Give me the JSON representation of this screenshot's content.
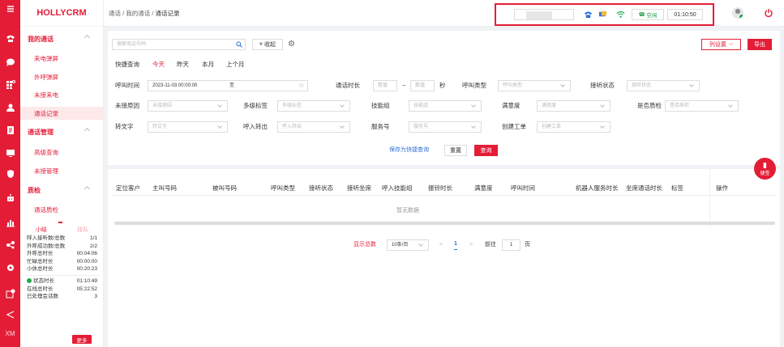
{
  "brand": "HOLLYCRM",
  "rail_icons": [
    "menu-icon",
    "phone-icon",
    "chat-icon",
    "grid-icon",
    "user-icon",
    "document-icon",
    "monitor-icon",
    "shield-icon",
    "robot-icon",
    "chart-icon",
    "share-icon",
    "settings-icon",
    "calendar-icon",
    "send-icon"
  ],
  "rail_footer": "XM",
  "sidebar": {
    "groups": [
      {
        "label": "我的通话",
        "items": [
          "来电弹屏",
          "外呼弹屏",
          "未接来电",
          "通话记录"
        ]
      },
      {
        "label": "通话管理",
        "items": [
          "高级查询",
          "未接管理"
        ]
      },
      {
        "label": "质检",
        "items": [
          "通话质检"
        ]
      }
    ],
    "stats_tabs": {
      "active": "小结",
      "inactive": "技队"
    },
    "stats": [
      {
        "label": "呼入接听数/总数",
        "value": "1/1"
      },
      {
        "label": "外呼成功数/总数",
        "value": "2/2"
      },
      {
        "label": "外呼总时长",
        "value": "00:04:06"
      },
      {
        "label": "忙碌总时长",
        "value": "00:00:00"
      },
      {
        "label": "小休总时长",
        "value": "00:20:23"
      }
    ],
    "stats2": [
      {
        "label": "状态时长",
        "value": "01:10:49"
      },
      {
        "label": "在线总时长",
        "value": "05:22:52"
      },
      {
        "label": "已处理会话数",
        "value": "3"
      }
    ],
    "more": "更多"
  },
  "breadcrumb": [
    "通话",
    "我的通话",
    "通话记录"
  ],
  "topbar": {
    "state": "空闲",
    "timer": "01:10:50"
  },
  "filters": {
    "search_placeholder": "搜索电话号码",
    "collapse_label": "收起",
    "column_settings": "列设置",
    "export": "导出",
    "quick_label": "快捷查询",
    "quick": [
      "今天",
      "昨天",
      "本月",
      "上个月"
    ],
    "call_time_label": "呼叫时间",
    "call_time_value": "2023-11-03 00:00:00",
    "to_label": "至",
    "duration_label": "通话时长",
    "min_placeholder": "数值",
    "max_placeholder": "数值",
    "sec": "秒",
    "call_type_label": "呼叫类型",
    "call_type_placeholder": "呼叫类型",
    "answer_label": "接听状态",
    "answer_placeholder": "接听状态",
    "missed_label": "未接原因",
    "missed_placeholder": "未接原因",
    "tags_label": "多级标签",
    "tags_placeholder": "多级标签",
    "skill_label": "技能组",
    "skill_placeholder": "技能组",
    "satisfaction_label": "满意度",
    "satisfaction_placeholder": "满意度",
    "qc_label": "是否质检",
    "qc_placeholder": "是否质检",
    "transcribe_label": "转文字",
    "transcribe_placeholder": "转文字",
    "transfer_label": "呼入转出",
    "transfer_placeholder": "呼入转出",
    "service_label": "服务号",
    "service_placeholder": "服务号",
    "ticket_label": "创建工单",
    "ticket_placeholder": "创建工单",
    "save_quick": "保存为快捷查询",
    "reset": "重置",
    "query": "查询"
  },
  "table": {
    "columns": [
      "定位客户",
      "主叫号码",
      "被叫号码",
      "呼叫类型",
      "接听状态",
      "接听坐席",
      "呼入技能组",
      "振铃时长",
      "满意度",
      "呼叫时间",
      "机器人服务时长",
      "坐席通话时长",
      "标签",
      "操作"
    ],
    "empty": "暂无数据"
  },
  "pagination": {
    "total": "显示总数",
    "page_size": "10条/页",
    "current": "1",
    "goto": "前往",
    "goto_value": "1",
    "page_unit": "页"
  },
  "float_button": "便签"
}
